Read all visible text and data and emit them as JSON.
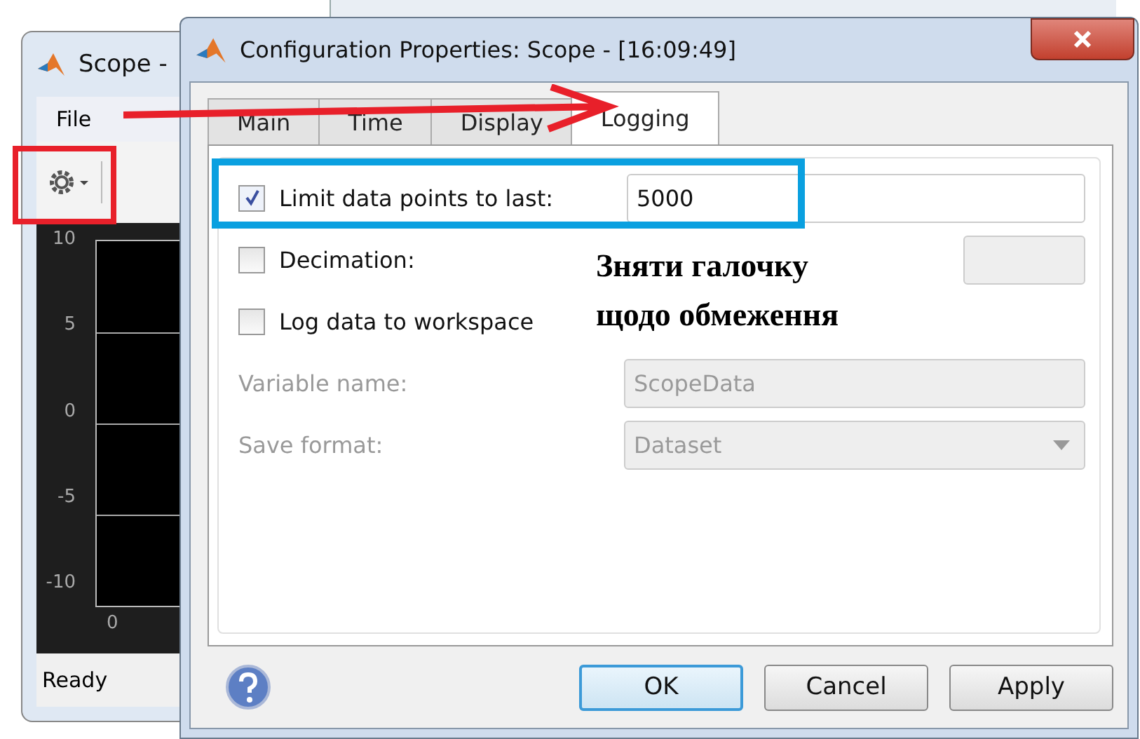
{
  "scope_window": {
    "title": "Scope -",
    "menu": [
      "File"
    ],
    "y_ticks": [
      "10",
      "5",
      "0",
      "-5",
      "-10"
    ],
    "x_ticks": [
      "0"
    ],
    "status_bar": "Ready"
  },
  "dialog": {
    "title": "Configuration Properties: Scope - [16:09:49]",
    "tabs": [
      {
        "label": "Main",
        "selected": false
      },
      {
        "label": "Time",
        "selected": false
      },
      {
        "label": "Display",
        "selected": false
      },
      {
        "label": "Logging",
        "selected": true
      }
    ],
    "rows": [
      {
        "kind": "checkbox",
        "label": "Limit data points to last:",
        "checked": true,
        "value": "5000",
        "disabled": false
      },
      {
        "kind": "checkbox",
        "label": "Decimation:",
        "checked": false,
        "disabled": true
      },
      {
        "kind": "checkbox",
        "label": "Log data to workspace",
        "checked": false
      },
      {
        "kind": "text",
        "label": "Variable name:",
        "value": "ScopeData",
        "disabled": true
      },
      {
        "kind": "select",
        "label": "Save format:",
        "value": "Dataset",
        "disabled": true
      }
    ],
    "buttons": [
      {
        "label": "OK",
        "default": true
      },
      {
        "label": "Cancel",
        "default": false
      },
      {
        "label": "Apply",
        "default": false
      }
    ]
  },
  "annotation": {
    "text": "Зняти галочку щодо обмеження"
  }
}
